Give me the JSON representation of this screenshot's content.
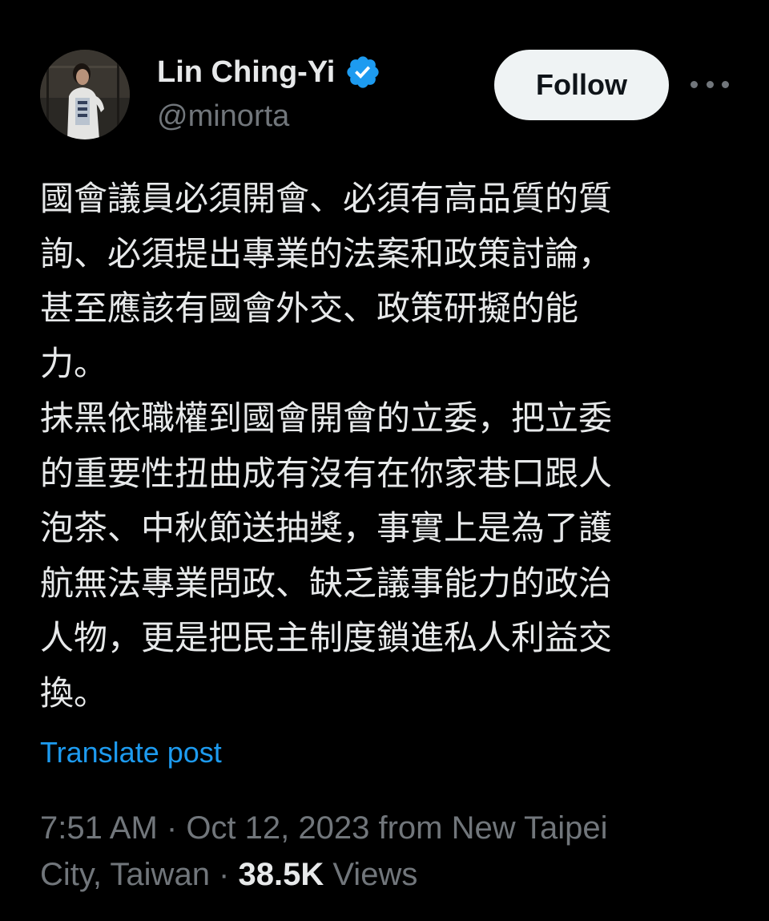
{
  "author": {
    "display_name": "Lin Ching-Yi",
    "handle": "@minorta",
    "verified": true,
    "avatar_icon": "profile-photo"
  },
  "actions": {
    "follow_label": "Follow",
    "more_icon": "ellipsis-icon"
  },
  "post": {
    "lines": [
      "國會議員必須開會、必須有高品質的質",
      "詢、必須提出專業的法案和政策討論，",
      "甚至應該有國會外交、政策研擬的能",
      "力。",
      "抹黑依職權到國會開會的立委，把立委",
      "的重要性扭曲成有沒有在你家巷口跟人",
      "泡茶、中秋節送抽獎，事實上是為了護",
      "航無法專業問政、缺乏議事能力的政治",
      "人物，更是把民主制度鎖進私人利益交",
      "換。"
    ],
    "translate_label": "Translate post"
  },
  "meta": {
    "time": "7:51 AM",
    "sep1": " · ",
    "date": "Oct 12, 2023",
    "location_prefix": " from New Taipei",
    "location_line2": "City, Taiwan",
    "sep2": " · ",
    "views_count": "38.5K",
    "views_label": " Views"
  },
  "colors": {
    "background": "#000000",
    "text_primary": "#e7e9ea",
    "text_secondary": "#71767b",
    "link": "#1d9bf0",
    "verified_badge": "#1d9bf0",
    "follow_bg": "#eff3f4",
    "follow_text": "#0f1419"
  }
}
